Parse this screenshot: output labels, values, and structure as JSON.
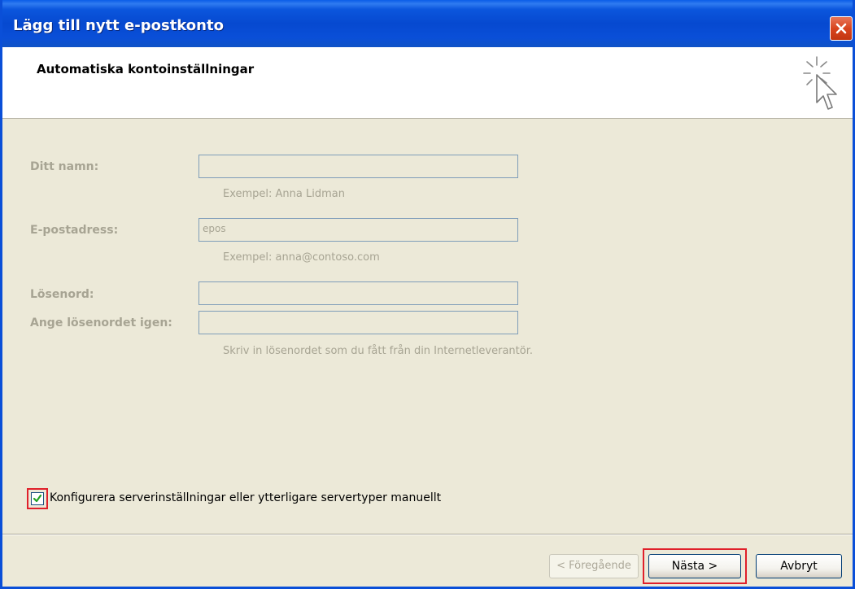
{
  "window": {
    "title": "Lägg till nytt e-postkonto"
  },
  "header": {
    "title": "Automatiska kontoinställningar",
    "icon": "cursor-sparkle-icon"
  },
  "form": {
    "name_label": "Ditt namn:",
    "name_value": "",
    "name_hint": "Exempel: Anna Lidman",
    "email_label": "E-postadress:",
    "email_value": "epos",
    "email_hint": "Exempel: anna@contoso.com",
    "password_label": "Lösenord:",
    "password_value": "",
    "password_confirm_label": "Ange lösenordet igen:",
    "password_confirm_value": "",
    "password_hint": "Skriv in lösenordet som du fått från din Internetleverantör."
  },
  "manual_config": {
    "label": "Konfigurera serverinställningar eller ytterligare servertyper manuellt",
    "checked": true
  },
  "buttons": {
    "back": "< Föregående",
    "next": "Nästa >",
    "cancel": "Avbryt"
  },
  "colors": {
    "titlebar": "#0a4fd8",
    "dialog_bg": "#ece9d8",
    "highlight": "#e0202a",
    "disabled_text": "#a7a493"
  }
}
